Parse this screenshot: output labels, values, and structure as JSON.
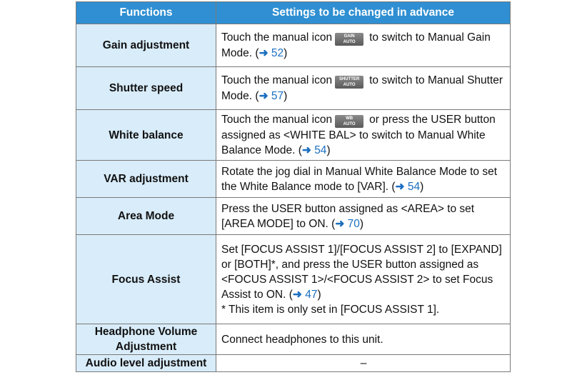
{
  "header": {
    "col_functions": "Functions",
    "col_settings": "Settings to be changed in advance"
  },
  "rows": [
    {
      "function": "Gain adjustment",
      "pre": "Touch the manual icon",
      "icon": {
        "line1": "GAIN",
        "line2": "AUTO",
        "name": "gain-auto-icon"
      },
      "post": "to switch to Manual Gain Mode. (",
      "arrow": "➜",
      "page": "52",
      "close": ")"
    },
    {
      "function": "Shutter speed",
      "pre": "Touch the manual icon",
      "icon": {
        "line1": "SHUTTER",
        "line2": "AUTO",
        "name": "shutter-auto-icon"
      },
      "post": "to switch to Manual Shutter Mode. (",
      "arrow": "➜",
      "page": "57",
      "close": ")"
    },
    {
      "function": "White balance",
      "pre": "Touch the manual icon",
      "icon": {
        "line1": "WB",
        "line2": "AUTO",
        "name": "wb-auto-icon"
      },
      "post": "or press the USER button assigned as <WHITE BAL> to switch to Manual White Balance Mode. (",
      "arrow": "➜",
      "page": "54",
      "close": ")"
    },
    {
      "function": "VAR adjustment",
      "pre": "Rotate the jog dial in Manual White Balance Mode to set the White Balance mode to [VAR]. (",
      "arrow": "➜",
      "page": "54",
      "close": ")"
    },
    {
      "function": "Area Mode",
      "pre": "Press the USER button assigned as <AREA> to set [AREA MODE] to ON. (",
      "arrow": "➜",
      "page": "70",
      "close": ")"
    },
    {
      "function": "Focus Assist",
      "pre": "Set [FOCUS ASSIST 1]/[FOCUS ASSIST 2] to [EXPAND] or [BOTH]*, and press the USER button assigned as <FOCUS ASSIST 1>/<FOCUS ASSIST 2> to set Focus Assist to ON. (",
      "arrow": "➜",
      "page": "47",
      "close": ")",
      "note": "*  This item is only set in [FOCUS ASSIST 1]."
    },
    {
      "function": "Headphone Volume Adjustment",
      "pre": "Connect headphones to this unit."
    },
    {
      "function": "Audio level adjustment",
      "pre": "–"
    }
  ]
}
